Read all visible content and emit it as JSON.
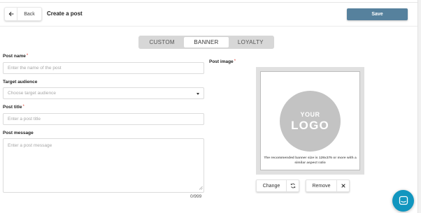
{
  "header": {
    "back_label": "Back",
    "back_icon": "arrow-left-icon",
    "title": "Create a post",
    "save_label": "Save",
    "save_color": "#56819d"
  },
  "tabs": [
    {
      "label": "CUSTOM",
      "active": false
    },
    {
      "label": "BANNER",
      "active": true
    },
    {
      "label": "LOYALTY",
      "active": false
    }
  ],
  "form": {
    "post_name": {
      "label": "Post name",
      "required_mark": "*",
      "value": "",
      "placeholder": "Enter the name of the post"
    },
    "target_audience": {
      "label": "Target audience",
      "selected": "Choose target audience"
    },
    "post_title": {
      "label": "Post title",
      "required_mark": "*",
      "value": "",
      "placeholder": "Enter a post title"
    },
    "post_message": {
      "label": "Post message",
      "value": "",
      "placeholder": "Enter a post message",
      "counter": "0/999"
    }
  },
  "post_image": {
    "label": "Post image",
    "required_mark": "*",
    "logo_line1": "YOUR",
    "logo_line2": "LOGO",
    "note": "The recommended banner size is 129x375 or more with a similar aspect ratio",
    "change_label": "Change",
    "change_icon": "refresh-icon",
    "remove_label": "Remove",
    "remove_icon": "close-icon"
  },
  "chat": {
    "icon": "chat-icon",
    "color": "#1196bf"
  }
}
